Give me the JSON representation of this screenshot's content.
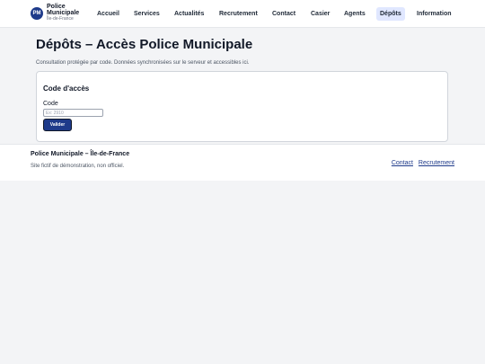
{
  "brand": {
    "logo_text": "PM",
    "name_line1": "Police",
    "name_line2": "Municipale",
    "region": "Île-de-France"
  },
  "nav": {
    "items": [
      "Accueil",
      "Services",
      "Actualités",
      "Recrutement",
      "Contact",
      "Casier",
      "Agents",
      "Dépôts",
      "Information"
    ],
    "active": "Dépôts"
  },
  "page": {
    "title": "Dépôts – Accès Police Municipale",
    "description": "Consultation protégée par code. Données synchronisées sur le serveur et accessibles ici."
  },
  "access_form": {
    "title": "Code d'accès",
    "field_label": "Code",
    "field_value": "",
    "placeholder": "Ex: 2910",
    "submit_label": "Valider"
  },
  "footer": {
    "name": "Police Municipale – Île-de-France",
    "note": "Site fictif de démonstration, non officiel.",
    "links": [
      "Contact",
      "Recrutement"
    ]
  },
  "colors": {
    "primary": "#1e3a8a",
    "active_nav_bg": "#e0e7ff",
    "page_bg": "#f3f4f6"
  }
}
